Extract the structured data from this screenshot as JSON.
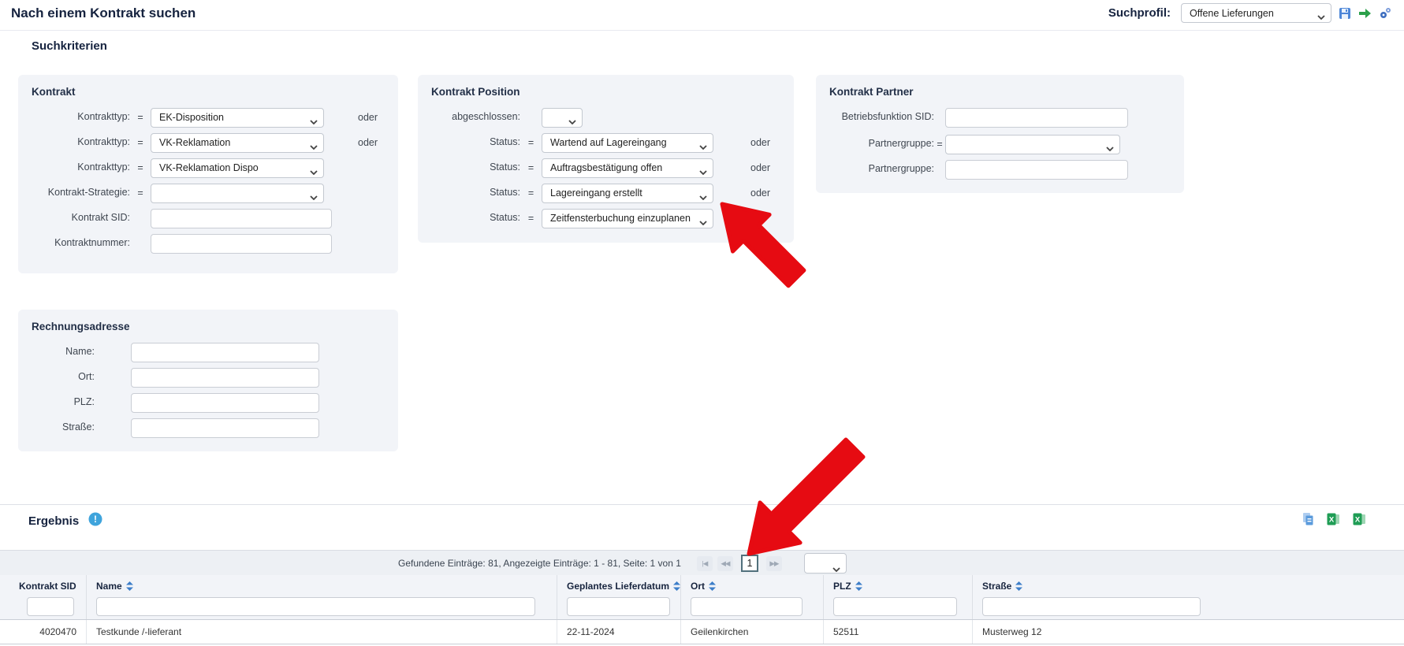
{
  "header": {
    "title": "Nach einem Kontrakt suchen",
    "suchprofil_label": "Suchprofil:",
    "suchprofil_value": "Offene Lieferungen"
  },
  "suchkriterien": {
    "title": "Suchkriterien",
    "oder": "oder",
    "kontrakt": {
      "title": "Kontrakt",
      "rows": [
        {
          "label": "Kontrakttyp:",
          "op": "=",
          "value": "EK-Disposition",
          "suffix": "oder"
        },
        {
          "label": "Kontrakttyp:",
          "op": "=",
          "value": "VK-Reklamation",
          "suffix": "oder"
        },
        {
          "label": "Kontrakttyp:",
          "op": "=",
          "value": "VK-Reklamation Dispo",
          "suffix": ""
        },
        {
          "label": "Kontrakt-Strategie:",
          "op": "=",
          "value": "",
          "suffix": ""
        },
        {
          "label": "Kontrakt SID:",
          "value": ""
        },
        {
          "label": "Kontraktnummer:",
          "value": ""
        }
      ]
    },
    "kontrakt_position": {
      "title": "Kontrakt Position",
      "rows": [
        {
          "label": "abgeschlossen:",
          "op": "",
          "value": "",
          "suffix": ""
        },
        {
          "label": "Status:",
          "op": "=",
          "value": "Wartend auf Lagereingang",
          "suffix": "oder"
        },
        {
          "label": "Status:",
          "op": "=",
          "value": "Auftragsbestätigung offen",
          "suffix": "oder"
        },
        {
          "label": "Status:",
          "op": "=",
          "value": "Lagereingang erstellt",
          "suffix": "oder"
        },
        {
          "label": "Status:",
          "op": "=",
          "value": "Zeitfensterbuchung einzuplanen",
          "suffix": ""
        }
      ]
    },
    "kontrakt_partner": {
      "title": "Kontrakt Partner",
      "rows": [
        {
          "label": "Betriebsfunktion SID:",
          "op": "",
          "value": ""
        },
        {
          "label": "Partnergruppe:",
          "op": "=",
          "value": ""
        },
        {
          "label": "Partnergruppe:",
          "op": "",
          "value": ""
        }
      ]
    },
    "rechnungsadresse": {
      "title": "Rechnungsadresse",
      "rows": [
        {
          "label": "Name:",
          "value": ""
        },
        {
          "label": "Ort:",
          "value": ""
        },
        {
          "label": "PLZ:",
          "value": ""
        },
        {
          "label": "Straße:",
          "value": ""
        }
      ]
    }
  },
  "ergebnis": {
    "title": "Ergebnis",
    "summary": "Gefundene Einträge: 81, Angezeigte Einträge: 1 - 81, Seite: 1 von 1",
    "pager": {
      "first": "|◀",
      "prev": "◀◀",
      "page": "1",
      "next": "▶▶"
    },
    "table": {
      "columns": [
        {
          "label": "Kontrakt SID"
        },
        {
          "label": "Name"
        },
        {
          "label": "Geplantes Lieferdatum"
        },
        {
          "label": "Ort"
        },
        {
          "label": "PLZ"
        },
        {
          "label": "Straße"
        }
      ],
      "rows": [
        [
          "4020470",
          "Testkunde /-lieferant",
          "22-11-2024",
          "Geilenkirchen",
          "52511",
          "Musterweg 12"
        ]
      ]
    }
  },
  "colors": {
    "annotation_arrow": "#e60b12",
    "title_text": "#16233f",
    "panel_bg": "#f2f4f8",
    "info_icon": "#3fa4dc",
    "excel_icon": "#1f9d55",
    "sort_icon": "#3d7ec9"
  }
}
